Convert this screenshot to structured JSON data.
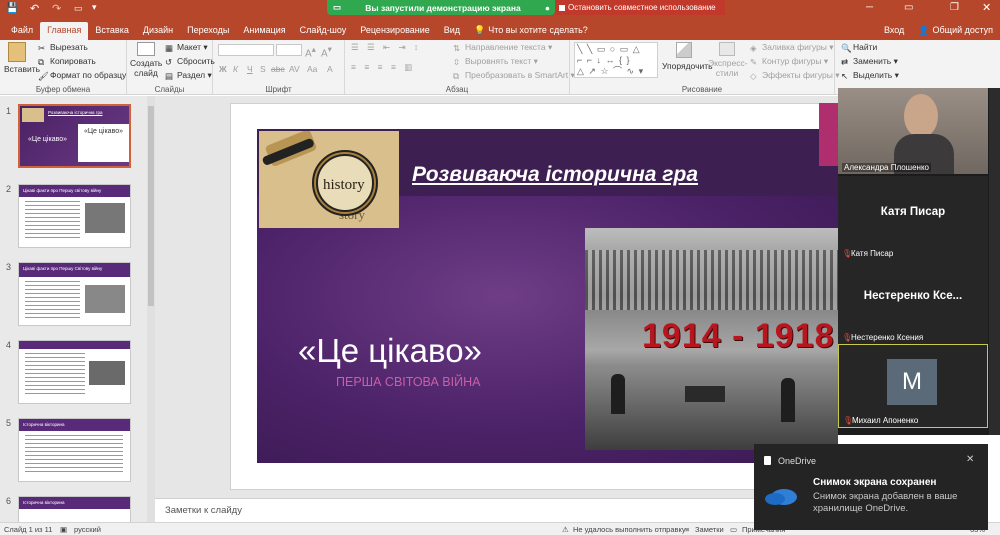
{
  "titlebar": {
    "share_status": "Вы запустили демонстрацию экрана",
    "stop_label": "Остановить совместное использование"
  },
  "tabs": [
    "Файл",
    "Главная",
    "Вставка",
    "Дизайн",
    "Переходы",
    "Анимация",
    "Слайд-шоу",
    "Рецензирование",
    "Вид"
  ],
  "tell_me": "Что вы хотите сделать?",
  "account": {
    "signin": "Вход",
    "share": "Общий доступ"
  },
  "ribbon": {
    "clipboard": {
      "paste": "Вставить",
      "cut": "Вырезать",
      "copy": "Копировать",
      "format_painter": "Формат по образцу",
      "label": "Буфер обмена"
    },
    "slides": {
      "new_slide": "Создать слайд",
      "layout": "Макет",
      "reset": "Сбросить",
      "section": "Раздел",
      "label": "Слайды"
    },
    "font": {
      "label": "Шрифт",
      "buttons": [
        "Ж",
        "К",
        "Ч",
        "S",
        "abc",
        "AV",
        "Aa",
        "A"
      ]
    },
    "paragraph": {
      "text_direction": "Направление текста",
      "align_text": "Выровнять текст",
      "smartart": "Преобразовать в SmartArt",
      "label": "Абзац"
    },
    "drawing": {
      "arrange": "Упорядочить",
      "quick_styles": "Экспресс-стили",
      "fill": "Заливка фигуры",
      "outline": "Контур фигуры",
      "effects": "Эффекты фигуры",
      "label": "Рисование"
    },
    "editing": {
      "find": "Найти",
      "replace": "Заменить",
      "select": "Выделить"
    }
  },
  "thumbnails": [
    {
      "num": "1",
      "title": "Розвиваюча історична гра",
      "quote": "«Це цікаво»"
    },
    {
      "num": "2",
      "title": "Цікаві факти про Першу світову війну"
    },
    {
      "num": "3",
      "title": "Цікаві факти про Першу Світову війну"
    },
    {
      "num": "4",
      "title": ""
    },
    {
      "num": "5",
      "title": "Історична вікторина"
    },
    {
      "num": "6",
      "title": "Історична вікторина"
    }
  ],
  "slide": {
    "title": "Розвиваюча історична гра",
    "quote": "«Це цікаво»",
    "subtitle": "ПЕРША СВІТОВА ВІЙНА",
    "years": "1914 - 1918",
    "magnifier_words": [
      "story",
      "history",
      "story"
    ]
  },
  "notes_placeholder": "Заметки к слайду",
  "status": {
    "slide_of": "Слайд 1 из 11",
    "language": "русский",
    "send_error": "Не удалось выполнить отправку",
    "notes": "Заметки",
    "comments": "Примечания",
    "zoom": "63%"
  },
  "participants": [
    {
      "name": "Александра Плошенко",
      "big": ""
    },
    {
      "name": "Катя Писар",
      "big": "Катя Писар"
    },
    {
      "name": "Нестеренко Ксения",
      "big": "Нестеренко  Ксе..."
    },
    {
      "name": "Михаил Апоненко",
      "big": "",
      "avatar": "M"
    }
  ],
  "toast": {
    "app": "OneDrive",
    "title": "Снимок экрана сохранен",
    "body": "Снимок экрана добавлен в ваше хранилище OneDrive."
  },
  "colors": {
    "accent": "#b7472a",
    "share_green": "#2fa84f",
    "stop_red": "#c0392b",
    "slide_purple": "#4c2268",
    "quote_pink": "#c85fa8",
    "years_red": "#b8161e"
  }
}
